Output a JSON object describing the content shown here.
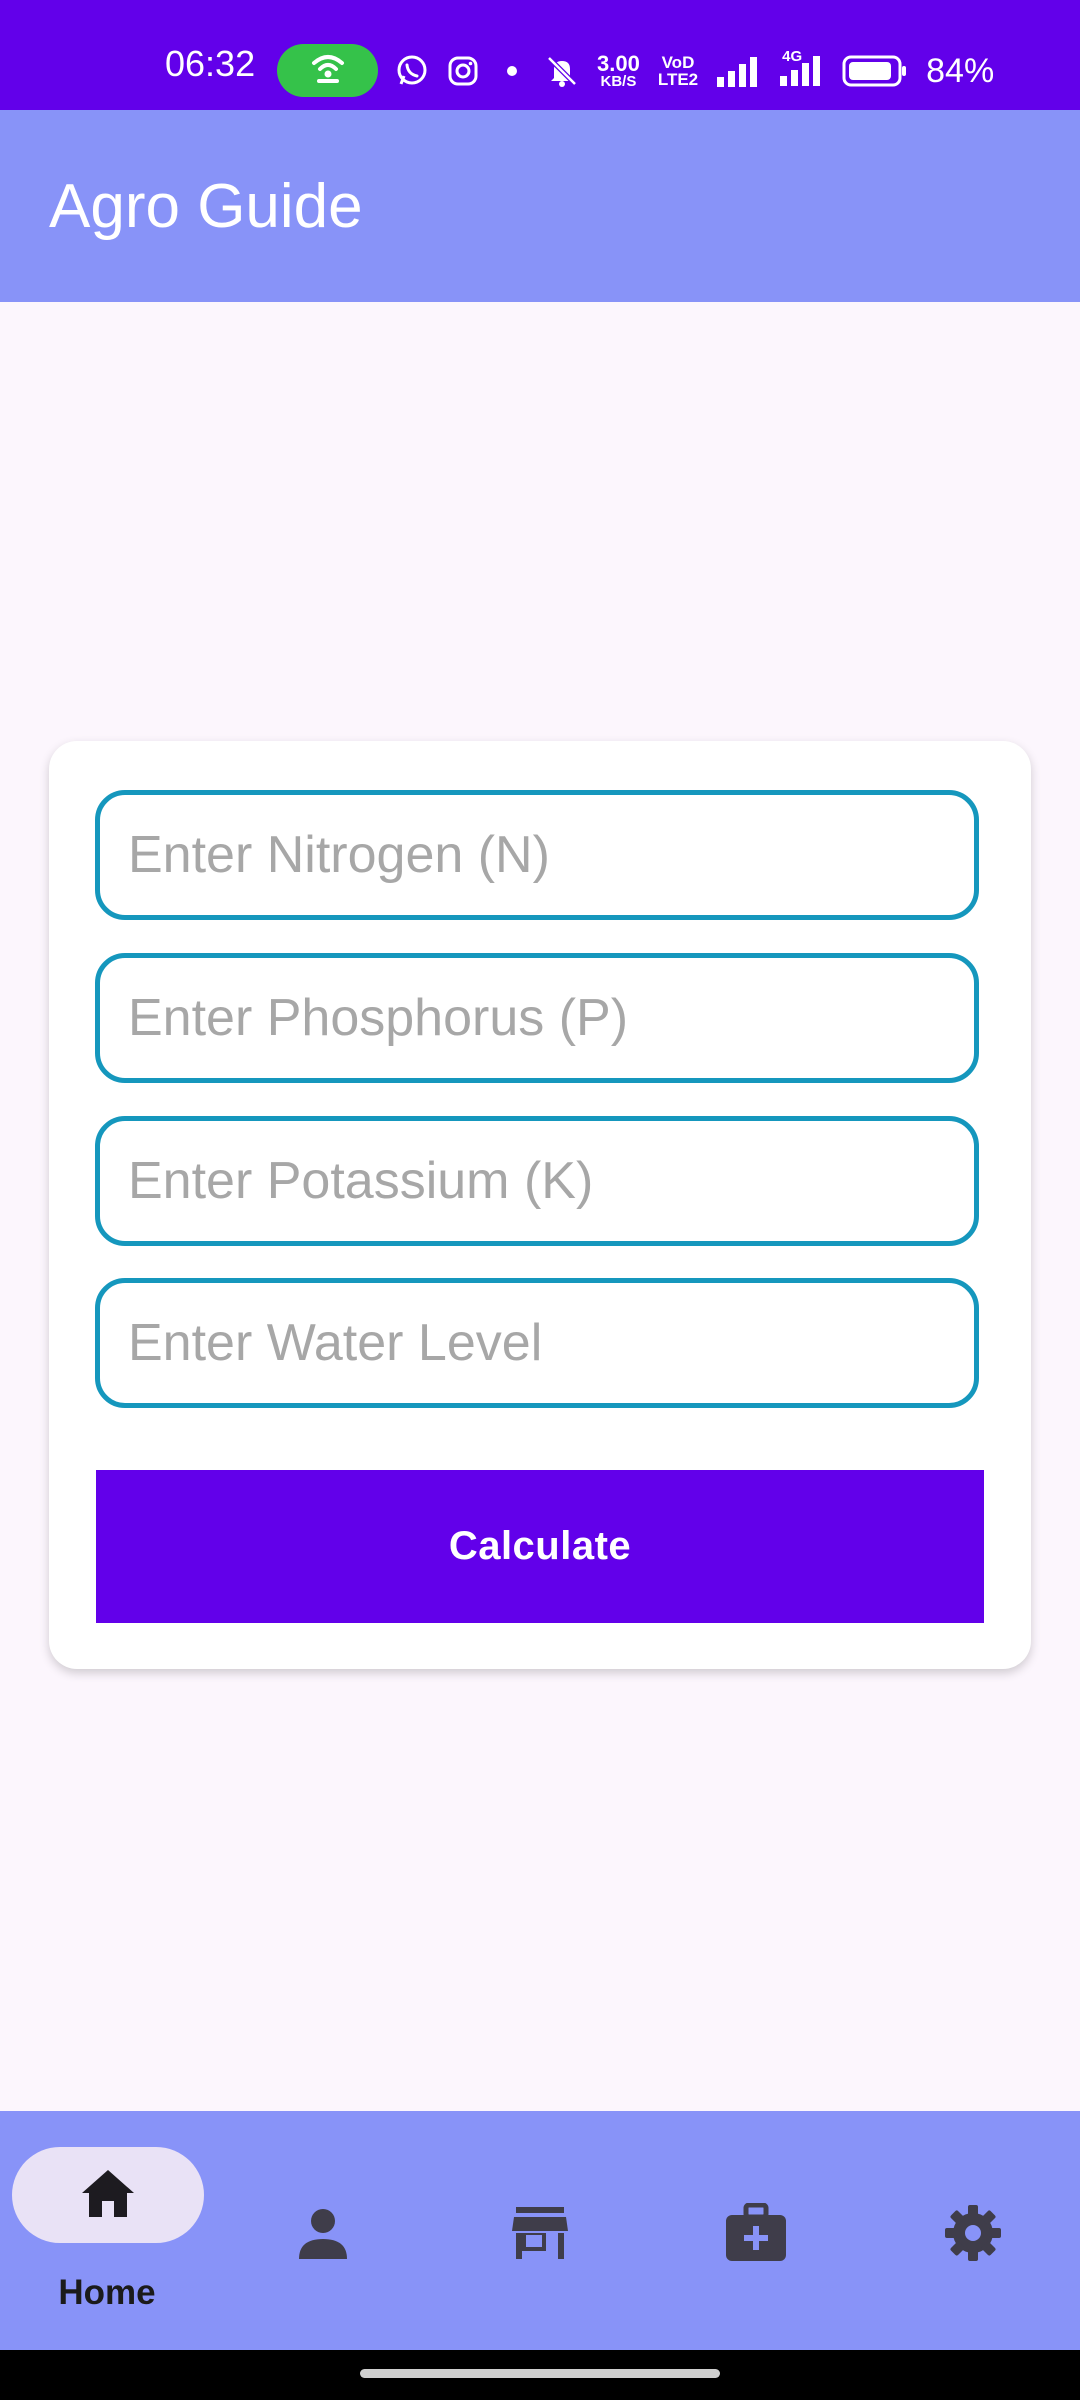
{
  "status_bar": {
    "time": "06:32",
    "speed_value": "3.00",
    "speed_unit": "KB/S",
    "volte_top": "VoD",
    "volte_bottom": "LTE2",
    "network_type": "4G",
    "battery": "84%",
    "icons": [
      "hotspot-icon",
      "whatsapp-icon",
      "instagram-icon",
      "dot-icon",
      "bell-off-icon",
      "signal-icon",
      "battery-icon"
    ]
  },
  "app_bar": {
    "title": "Agro Guide"
  },
  "form": {
    "nitrogen": {
      "placeholder": "Enter Nitrogen (N)",
      "value": ""
    },
    "phosphorus": {
      "placeholder": "Enter Phosphorus (P)",
      "value": ""
    },
    "potassium": {
      "placeholder": "Enter Potassium (K)",
      "value": ""
    },
    "water": {
      "placeholder": "Enter Water Level",
      "value": ""
    },
    "calculate_label": "Calculate"
  },
  "bottom_nav": {
    "items": [
      {
        "label": "Home",
        "icon": "home-icon",
        "selected": true
      },
      {
        "label": "",
        "icon": "person-icon",
        "selected": false
      },
      {
        "label": "",
        "icon": "store-icon",
        "selected": false
      },
      {
        "label": "",
        "icon": "medical-kit-icon",
        "selected": false
      },
      {
        "label": "",
        "icon": "gear-icon",
        "selected": false
      }
    ]
  },
  "colors": {
    "status_bar": "#6200ea",
    "app_bar": "#8893f8",
    "field_border": "#1597bd",
    "button": "#6200ea",
    "background": "#fcf6fd",
    "nav_selected_pill": "#e9e2f6"
  }
}
